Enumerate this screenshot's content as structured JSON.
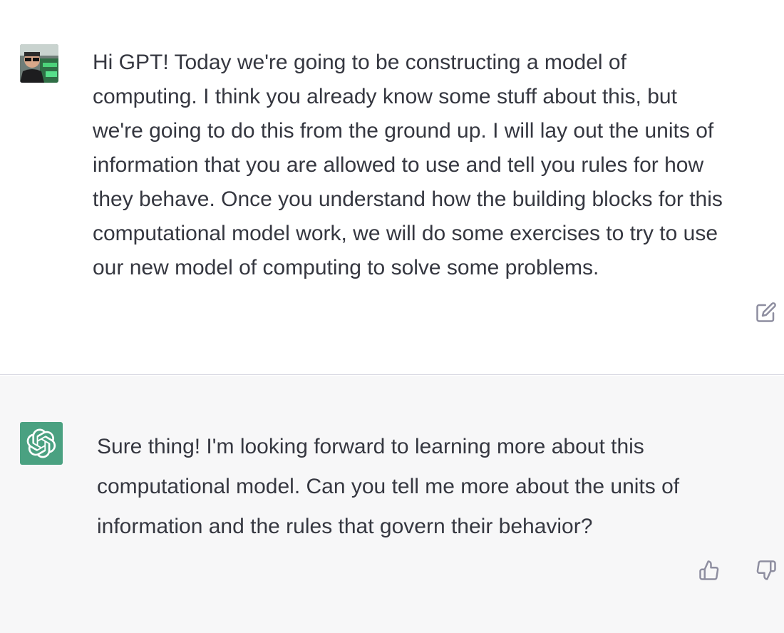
{
  "conversation": {
    "user_message": {
      "text": "Hi GPT! Today we're going to be constructing a model of\ncomputing. I think you already know some stuff about this, but\nwe're going to do this from the ground up. I will lay out the units of\ninformation that you are allowed to use and tell you rules for how\nthey behave. Once you understand how the building blocks for this\ncomputational model work, we will do some exercises to try to use\nour new model of computing to solve some problems.",
      "avatar_icon": "user-photo-avatar",
      "action_icon": "edit-icon"
    },
    "assistant_message": {
      "text": "Sure thing! I'm looking forward to learning more about this\ncomputational model. Can you tell me more about the units of\ninformation and the rules that govern their behavior?",
      "avatar_icon": "openai-logo-icon",
      "avatar_color": "#4aa181",
      "action_icons": [
        "thumbs-up-icon",
        "thumbs-down-icon"
      ]
    }
  },
  "colors": {
    "text": "#353740",
    "assistant_bg": "#f7f7f8",
    "divider": "#d9d9e3",
    "icon": "#8e8ea0"
  }
}
